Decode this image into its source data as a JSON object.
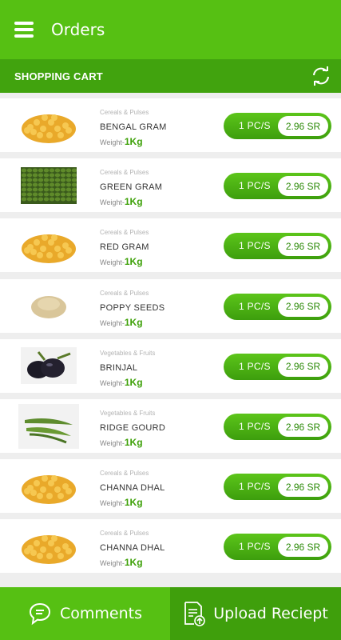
{
  "header": {
    "title": "Orders",
    "menu_icon": "hamburger-menu-icon"
  },
  "subheader": {
    "title": "SHOPPING CART",
    "refresh_icon": "refresh-icon"
  },
  "items": [
    {
      "category": "Cereals & Pulses",
      "name": "BENGAL GRAM",
      "weight_label": "Weight-",
      "weight": "1Kg",
      "qty": "1 PC/S",
      "price": "2.96 SR",
      "image": "bengal-gram-image"
    },
    {
      "category": "Cereals & Pulses",
      "name": "GREEN GRAM",
      "weight_label": "Weight-",
      "weight": "1Kg",
      "qty": "1 PC/S",
      "price": "2.96 SR",
      "image": "green-gram-image"
    },
    {
      "category": "Cereals & Pulses",
      "name": "RED GRAM",
      "weight_label": "Weight-",
      "weight": "1Kg",
      "qty": "1 PC/S",
      "price": "2.96 SR",
      "image": "red-gram-image"
    },
    {
      "category": "Cereals & Pulses",
      "name": "POPPY SEEDS",
      "weight_label": "Weight-",
      "weight": "1Kg",
      "qty": "1 PC/S",
      "price": "2.96 SR",
      "image": "poppy-seeds-image"
    },
    {
      "category": "Vegetables & Fruits",
      "name": "BRINJAL",
      "weight_label": "Weight-",
      "weight": "1Kg",
      "qty": "1 PC/S",
      "price": "2.96 SR",
      "image": "brinjal-image"
    },
    {
      "category": "Vegetables & Fruits",
      "name": "RIDGE GOURD",
      "weight_label": "Weight-",
      "weight": "1Kg",
      "qty": "1 PC/S",
      "price": "2.96 SR",
      "image": "ridge-gourd-image"
    },
    {
      "category": "Cereals & Pulses",
      "name": "CHANNA DHAL",
      "weight_label": "Weight-",
      "weight": "1Kg",
      "qty": "1 PC/S",
      "price": "2.96 SR",
      "image": "channa-dhal-image"
    },
    {
      "category": "Cereals & Pulses",
      "name": "CHANNA DHAL",
      "weight_label": "Weight-",
      "weight": "1Kg",
      "qty": "1 PC/S",
      "price": "2.96 SR",
      "image": "channa-dhal-image"
    }
  ],
  "footer": {
    "comments_label": "Comments",
    "comments_icon": "chat-bubble-icon",
    "upload_label": "Upload Reciept",
    "upload_icon": "upload-document-icon"
  },
  "colors": {
    "primary": "#56c013",
    "dark": "#41a30e",
    "accent_text": "#3fa10a"
  }
}
